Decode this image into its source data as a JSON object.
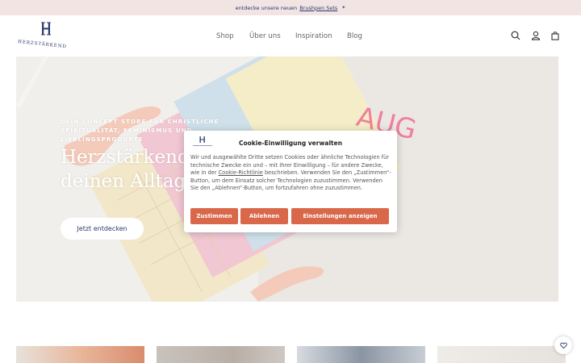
{
  "announcement": {
    "prefix": "entdecke unsere neuen",
    "link": "Brushpen Sets",
    "suffix": "✴"
  },
  "logo": {
    "wordmark": "HERZSTÄRKEND"
  },
  "nav": {
    "items": [
      {
        "label": "Shop"
      },
      {
        "label": "Über uns"
      },
      {
        "label": "Inspiration"
      },
      {
        "label": "Blog"
      }
    ]
  },
  "header_icons": [
    "search-icon",
    "account-icon",
    "cart-icon"
  ],
  "hero": {
    "eyebrow_line1": "DEIN CONCEPT STORE FÜR CHRISTLICHE",
    "eyebrow_line2": "SPIRITUALITÄT, FEMINISMUS UND",
    "eyebrow_line3": "LIEBLINGSPRODUKTE",
    "headline_line1": "Herzstärkend",
    "headline_line2": "deinen Alltag",
    "cta": "Jetzt entdecken",
    "calendar_text": "AUG"
  },
  "cookie": {
    "title": "Cookie-Einwilligung verwalten",
    "text_part1": "Wir und ausgewählte Dritte setzen Cookies oder ähnliche Technologien für technische Zwecke ein und – mit Ihrer Einwilligung – für andere Zwecke, wie in der",
    "link": "Cookie-Richtlinie",
    "text_part2": "beschrieben. Verwenden Sie den „Zustimmen“-Button, um dem Einsatz solcher Technologien zuzustimmen. Verwenden Sie den „Ablehnen“-Button, um fortzufahren ohne zuzustimmen.",
    "buttons": {
      "accept": "Zustimmen",
      "reject": "Ablehnen",
      "settings": "Einstellungen anzeigen"
    }
  },
  "colors": {
    "announcement_bg": "#f3e4e4",
    "brand_navy": "#2a3a6b",
    "cookie_button": "#d9684a"
  }
}
